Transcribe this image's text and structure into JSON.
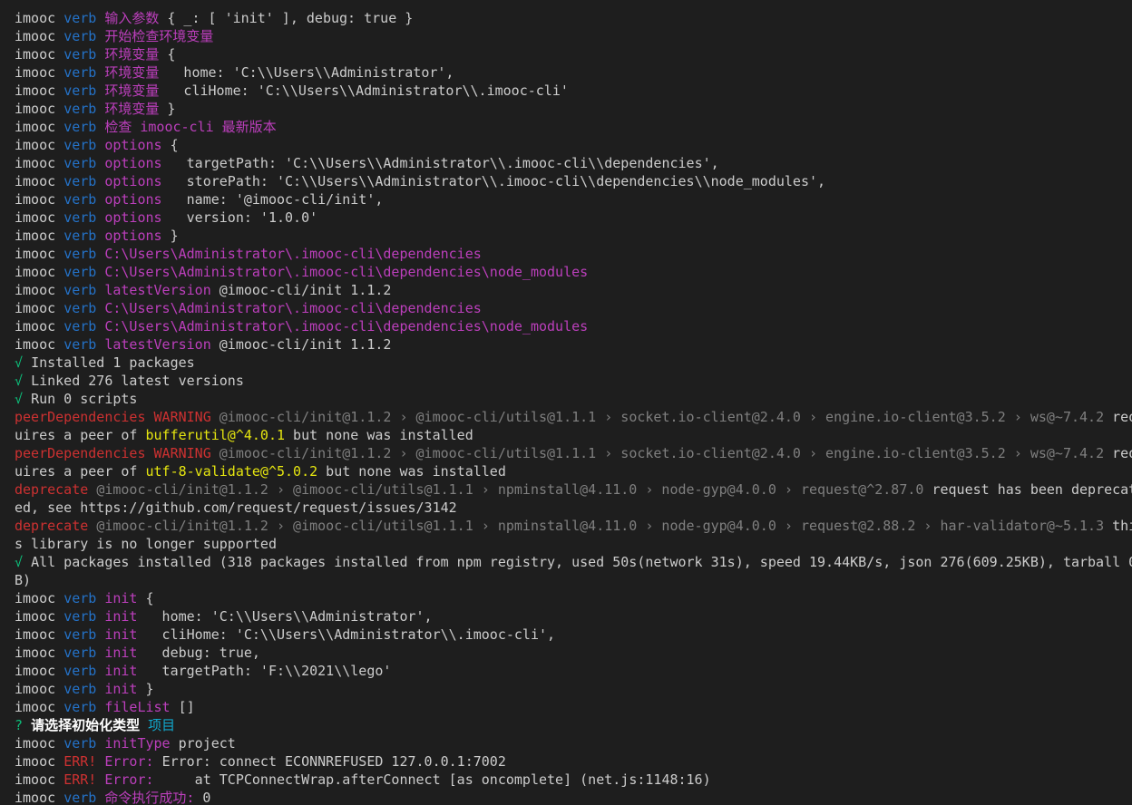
{
  "colors": {
    "background": "#1e1e1e",
    "default": "#cccccc",
    "blue": "#2472c8",
    "magenta": "#bc3fbc",
    "red": "#cd3131",
    "grey": "#7f7f7f",
    "yellow": "#e5e510",
    "green": "#0dbc79",
    "cyan": "#11a8cd"
  },
  "terminal": {
    "lines": [
      [
        {
          "t": "imooc ",
          "c": "default"
        },
        {
          "t": "verb ",
          "c": "blue"
        },
        {
          "t": "输入参数 ",
          "c": "magenta"
        },
        {
          "t": "{ _: [ 'init' ], debug: true }",
          "c": "default"
        }
      ],
      [
        {
          "t": "imooc ",
          "c": "default"
        },
        {
          "t": "verb ",
          "c": "blue"
        },
        {
          "t": "开始检查环境变量",
          "c": "magenta"
        }
      ],
      [
        {
          "t": "imooc ",
          "c": "default"
        },
        {
          "t": "verb ",
          "c": "blue"
        },
        {
          "t": "环境变量 ",
          "c": "magenta"
        },
        {
          "t": "{",
          "c": "default"
        }
      ],
      [
        {
          "t": "imooc ",
          "c": "default"
        },
        {
          "t": "verb ",
          "c": "blue"
        },
        {
          "t": "环境变量 ",
          "c": "magenta"
        },
        {
          "t": "  home: 'C:\\\\Users\\\\Administrator',",
          "c": "default"
        }
      ],
      [
        {
          "t": "imooc ",
          "c": "default"
        },
        {
          "t": "verb ",
          "c": "blue"
        },
        {
          "t": "环境变量 ",
          "c": "magenta"
        },
        {
          "t": "  cliHome: 'C:\\\\Users\\\\Administrator\\\\.imooc-cli'",
          "c": "default"
        }
      ],
      [
        {
          "t": "imooc ",
          "c": "default"
        },
        {
          "t": "verb ",
          "c": "blue"
        },
        {
          "t": "环境变量 ",
          "c": "magenta"
        },
        {
          "t": "}",
          "c": "default"
        }
      ],
      [
        {
          "t": "imooc ",
          "c": "default"
        },
        {
          "t": "verb ",
          "c": "blue"
        },
        {
          "t": "检查 imooc-cli 最新版本",
          "c": "magenta"
        }
      ],
      [
        {
          "t": "imooc ",
          "c": "default"
        },
        {
          "t": "verb ",
          "c": "blue"
        },
        {
          "t": "options ",
          "c": "magenta"
        },
        {
          "t": "{",
          "c": "default"
        }
      ],
      [
        {
          "t": "imooc ",
          "c": "default"
        },
        {
          "t": "verb ",
          "c": "blue"
        },
        {
          "t": "options ",
          "c": "magenta"
        },
        {
          "t": "  targetPath: 'C:\\\\Users\\\\Administrator\\\\.imooc-cli\\\\dependencies',",
          "c": "default"
        }
      ],
      [
        {
          "t": "imooc ",
          "c": "default"
        },
        {
          "t": "verb ",
          "c": "blue"
        },
        {
          "t": "options ",
          "c": "magenta"
        },
        {
          "t": "  storePath: 'C:\\\\Users\\\\Administrator\\\\.imooc-cli\\\\dependencies\\\\node_modules',",
          "c": "default"
        }
      ],
      [
        {
          "t": "imooc ",
          "c": "default"
        },
        {
          "t": "verb ",
          "c": "blue"
        },
        {
          "t": "options ",
          "c": "magenta"
        },
        {
          "t": "  name: '@imooc-cli/init',",
          "c": "default"
        }
      ],
      [
        {
          "t": "imooc ",
          "c": "default"
        },
        {
          "t": "verb ",
          "c": "blue"
        },
        {
          "t": "options ",
          "c": "magenta"
        },
        {
          "t": "  version: '1.0.0'",
          "c": "default"
        }
      ],
      [
        {
          "t": "imooc ",
          "c": "default"
        },
        {
          "t": "verb ",
          "c": "blue"
        },
        {
          "t": "options ",
          "c": "magenta"
        },
        {
          "t": "}",
          "c": "default"
        }
      ],
      [
        {
          "t": "imooc ",
          "c": "default"
        },
        {
          "t": "verb ",
          "c": "blue"
        },
        {
          "t": "C:\\Users\\Administrator\\.imooc-cli\\dependencies",
          "c": "magenta"
        }
      ],
      [
        {
          "t": "imooc ",
          "c": "default"
        },
        {
          "t": "verb ",
          "c": "blue"
        },
        {
          "t": "C:\\Users\\Administrator\\.imooc-cli\\dependencies\\node_modules",
          "c": "magenta"
        }
      ],
      [
        {
          "t": "imooc ",
          "c": "default"
        },
        {
          "t": "verb ",
          "c": "blue"
        },
        {
          "t": "latestVersion ",
          "c": "magenta"
        },
        {
          "t": "@imooc-cli/init 1.1.2",
          "c": "default"
        }
      ],
      [
        {
          "t": "imooc ",
          "c": "default"
        },
        {
          "t": "verb ",
          "c": "blue"
        },
        {
          "t": "C:\\Users\\Administrator\\.imooc-cli\\dependencies",
          "c": "magenta"
        }
      ],
      [
        {
          "t": "imooc ",
          "c": "default"
        },
        {
          "t": "verb ",
          "c": "blue"
        },
        {
          "t": "C:\\Users\\Administrator\\.imooc-cli\\dependencies\\node_modules",
          "c": "magenta"
        }
      ],
      [
        {
          "t": "imooc ",
          "c": "default"
        },
        {
          "t": "verb ",
          "c": "blue"
        },
        {
          "t": "latestVersion ",
          "c": "magenta"
        },
        {
          "t": "@imooc-cli/init 1.1.2",
          "c": "default"
        }
      ],
      [
        {
          "t": "√ ",
          "c": "green"
        },
        {
          "t": "Installed 1 packages",
          "c": "default"
        }
      ],
      [
        {
          "t": "√ ",
          "c": "green"
        },
        {
          "t": "Linked 276 latest versions",
          "c": "default"
        }
      ],
      [
        {
          "t": "√ ",
          "c": "green"
        },
        {
          "t": "Run 0 scripts",
          "c": "default"
        }
      ],
      [
        {
          "t": "peerDependencies WARNING ",
          "c": "red"
        },
        {
          "t": "@imooc-cli/init@1.1.2 › @imooc-cli/utils@1.1.1 › socket.io-client@2.4.0 › engine.io-client@3.5.2 › ws@~7.4.2 ",
          "c": "grey"
        },
        {
          "t": "req",
          "c": "default"
        }
      ],
      [
        {
          "t": "uires a peer of ",
          "c": "default"
        },
        {
          "t": "bufferutil@^4.0.1",
          "c": "yellow"
        },
        {
          "t": " but none was installed",
          "c": "default"
        }
      ],
      [
        {
          "t": "peerDependencies WARNING ",
          "c": "red"
        },
        {
          "t": "@imooc-cli/init@1.1.2 › @imooc-cli/utils@1.1.1 › socket.io-client@2.4.0 › engine.io-client@3.5.2 › ws@~7.4.2 ",
          "c": "grey"
        },
        {
          "t": "req",
          "c": "default"
        }
      ],
      [
        {
          "t": "uires a peer of ",
          "c": "default"
        },
        {
          "t": "utf-8-validate@^5.0.2",
          "c": "yellow"
        },
        {
          "t": " but none was installed",
          "c": "default"
        }
      ],
      [
        {
          "t": "deprecate ",
          "c": "red"
        },
        {
          "t": "@imooc-cli/init@1.1.2 › @imooc-cli/utils@1.1.1 › npminstall@4.11.0 › node-gyp@4.0.0 › request@^2.87.0 ",
          "c": "grey"
        },
        {
          "t": "request has been deprecat",
          "c": "default"
        }
      ],
      [
        {
          "t": "ed, see https://github.com/request/request/issues/3142",
          "c": "default"
        }
      ],
      [
        {
          "t": "deprecate ",
          "c": "red"
        },
        {
          "t": "@imooc-cli/init@1.1.2 › @imooc-cli/utils@1.1.1 › npminstall@4.11.0 › node-gyp@4.0.0 › request@2.88.2 › har-validator@~5.1.3 ",
          "c": "grey"
        },
        {
          "t": "thi",
          "c": "default"
        }
      ],
      [
        {
          "t": "s library is no longer supported",
          "c": "default"
        }
      ],
      [
        {
          "t": "√ ",
          "c": "green"
        },
        {
          "t": "All packages installed (318 packages installed from npm registry, used 50s(network 31s), speed 19.44KB/s, json 276(609.25KB), tarball 0",
          "c": "default"
        }
      ],
      [
        {
          "t": "B)",
          "c": "default"
        }
      ],
      [
        {
          "t": "imooc ",
          "c": "default"
        },
        {
          "t": "verb ",
          "c": "blue"
        },
        {
          "t": "init ",
          "c": "magenta"
        },
        {
          "t": "{",
          "c": "default"
        }
      ],
      [
        {
          "t": "imooc ",
          "c": "default"
        },
        {
          "t": "verb ",
          "c": "blue"
        },
        {
          "t": "init ",
          "c": "magenta"
        },
        {
          "t": "  home: 'C:\\\\Users\\\\Administrator',",
          "c": "default"
        }
      ],
      [
        {
          "t": "imooc ",
          "c": "default"
        },
        {
          "t": "verb ",
          "c": "blue"
        },
        {
          "t": "init ",
          "c": "magenta"
        },
        {
          "t": "  cliHome: 'C:\\\\Users\\\\Administrator\\\\.imooc-cli',",
          "c": "default"
        }
      ],
      [
        {
          "t": "imooc ",
          "c": "default"
        },
        {
          "t": "verb ",
          "c": "blue"
        },
        {
          "t": "init ",
          "c": "magenta"
        },
        {
          "t": "  debug: true,",
          "c": "default"
        }
      ],
      [
        {
          "t": "imooc ",
          "c": "default"
        },
        {
          "t": "verb ",
          "c": "blue"
        },
        {
          "t": "init ",
          "c": "magenta"
        },
        {
          "t": "  targetPath: 'F:\\\\2021\\\\lego'",
          "c": "default"
        }
      ],
      [
        {
          "t": "imooc ",
          "c": "default"
        },
        {
          "t": "verb ",
          "c": "blue"
        },
        {
          "t": "init ",
          "c": "magenta"
        },
        {
          "t": "}",
          "c": "default"
        }
      ],
      [
        {
          "t": "imooc ",
          "c": "default"
        },
        {
          "t": "verb ",
          "c": "blue"
        },
        {
          "t": "fileList ",
          "c": "magenta"
        },
        {
          "t": "[]",
          "c": "default"
        }
      ],
      [
        {
          "t": "? ",
          "c": "green"
        },
        {
          "t": "请选择初始化类型 ",
          "c": "white",
          "b": true
        },
        {
          "t": "项目",
          "c": "cyan"
        }
      ],
      [
        {
          "t": "imooc ",
          "c": "default"
        },
        {
          "t": "verb ",
          "c": "blue"
        },
        {
          "t": "initType ",
          "c": "magenta"
        },
        {
          "t": "project",
          "c": "default"
        }
      ],
      [
        {
          "t": "imooc ",
          "c": "default"
        },
        {
          "t": "ERR! ",
          "c": "red"
        },
        {
          "t": "Error: ",
          "c": "magenta"
        },
        {
          "t": "Error: connect ECONNREFUSED 127.0.0.1:7002",
          "c": "default"
        }
      ],
      [
        {
          "t": "imooc ",
          "c": "default"
        },
        {
          "t": "ERR! ",
          "c": "red"
        },
        {
          "t": "Error: ",
          "c": "magenta"
        },
        {
          "t": "    at TCPConnectWrap.afterConnect [as oncomplete] (net.js:1148:16)",
          "c": "default"
        }
      ],
      [
        {
          "t": "imooc ",
          "c": "default"
        },
        {
          "t": "verb ",
          "c": "blue"
        },
        {
          "t": "命令执行成功: ",
          "c": "magenta"
        },
        {
          "t": "0",
          "c": "default"
        }
      ]
    ]
  }
}
